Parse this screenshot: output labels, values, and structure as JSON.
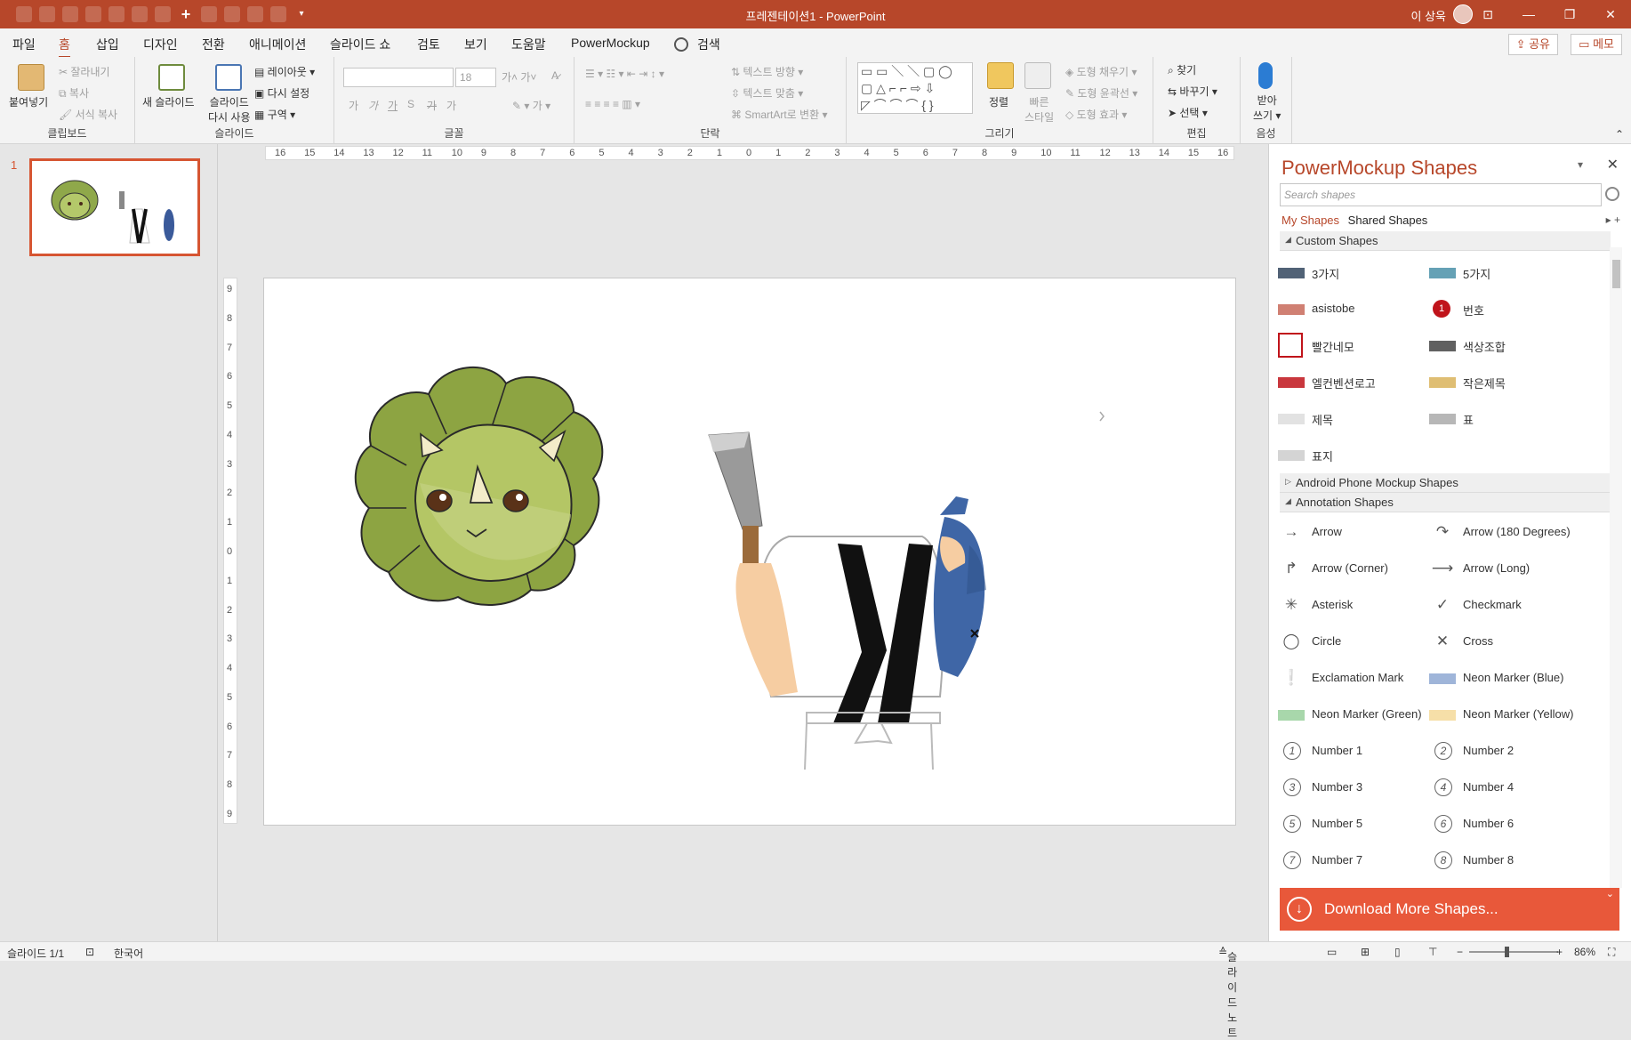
{
  "window": {
    "title": "프레젠테이션1  -  PowerPoint",
    "user": "이 상욱",
    "min": "—",
    "max": "❐",
    "close": "✕",
    "ribbon_opts": "⊡"
  },
  "menu": [
    {
      "label": "파일"
    },
    {
      "label": "홈"
    },
    {
      "label": "삽입"
    },
    {
      "label": "디자인"
    },
    {
      "label": "전환"
    },
    {
      "label": "애니메이션"
    },
    {
      "label": "슬라이드 쇼"
    },
    {
      "label": "검토"
    },
    {
      "label": "보기"
    },
    {
      "label": "도움말"
    },
    {
      "label": "PowerMockup"
    },
    {
      "label": "검색"
    }
  ],
  "share": "공유",
  "memo": "메모",
  "ribbon": {
    "clipboard": {
      "paste": "붙여넣기",
      "cut": "잘라내기",
      "copy": "복사",
      "format_copy": "서식 복사",
      "group": "클립보드"
    },
    "slides": {
      "new_slide": "새 슬라이드",
      "reuse1": "슬라이드",
      "reuse2": "다시 사용",
      "layout": "레이아웃",
      "reset": "다시 설정",
      "section": "구역",
      "group": "슬라이드"
    },
    "font": {
      "size": "18",
      "group": "글꼴",
      "g1": "가",
      "g2": "가",
      "g3": "가",
      "g4": "S",
      "g5": "가",
      "g6": "가"
    },
    "paragraph": {
      "text_dir": "텍스트 방향",
      "align_text": "텍스트 맞춤",
      "smartart": "SmartArt로 변환",
      "group": "단락"
    },
    "drawing": {
      "arrange1": "정렬",
      "quick1": "빠른",
      "quick2": "스타일",
      "fill": "도형 채우기",
      "outline": "도형 윤곽선",
      "effect": "도형 효과",
      "group": "그리기"
    },
    "editing": {
      "find": "찾기",
      "replace": "바꾸기",
      "select": "선택",
      "group": "편집"
    },
    "voice": {
      "dictate1": "받아",
      "dictate2": "쓰기",
      "group": "음성"
    }
  },
  "thumbnail": {
    "number": "1"
  },
  "hruler": [
    "16",
    "15",
    "14",
    "13",
    "12",
    "11",
    "10",
    "9",
    "8",
    "7",
    "6",
    "5",
    "4",
    "3",
    "2",
    "1",
    "0",
    "1",
    "2",
    "3",
    "4",
    "5",
    "6",
    "7",
    "8",
    "9",
    "10",
    "11",
    "12",
    "13",
    "14",
    "15",
    "16"
  ],
  "vruler": [
    "9",
    "8",
    "7",
    "6",
    "5",
    "4",
    "3",
    "2",
    "1",
    "0",
    "1",
    "2",
    "3",
    "4",
    "5",
    "6",
    "7",
    "8",
    "9"
  ],
  "slide": {
    "shirt_letter": "Y"
  },
  "pm": {
    "title": "PowerMockup Shapes",
    "search_placeholder": "Search shapes",
    "tab_my": "My Shapes",
    "tab_shared": "Shared Shapes",
    "sec_custom": "Custom Shapes",
    "custom": [
      "3가지",
      "5가지",
      "asistobe",
      "번호",
      "빨간네모",
      "색상조합",
      "엘컨벤션로고",
      "작은제목",
      "제목",
      "표",
      "표지"
    ],
    "number_badge": "1",
    "sec_android": "Android Phone Mockup Shapes",
    "sec_annotation": "Annotation Shapes",
    "annotation": [
      "Arrow",
      "Arrow (180 Degrees)",
      "Arrow (Corner)",
      "Arrow (Long)",
      "Asterisk",
      "Checkmark",
      "Circle",
      "Cross",
      "Exclamation Mark",
      "Neon Marker (Blue)",
      "Neon Marker (Green)",
      "Neon Marker (Yellow)",
      "Number 1",
      "Number 2",
      "Number 3",
      "Number 4",
      "Number 5",
      "Number 6",
      "Number 7",
      "Number 8"
    ],
    "number_glyphs": [
      "1",
      "2",
      "3",
      "4",
      "5",
      "6",
      "7",
      "8"
    ],
    "download": "Download More Shapes..."
  },
  "status": {
    "slide": "슬라이드 1/1",
    "lang": "한국어",
    "notes": "슬라이드 노트",
    "zoom": "86%"
  }
}
